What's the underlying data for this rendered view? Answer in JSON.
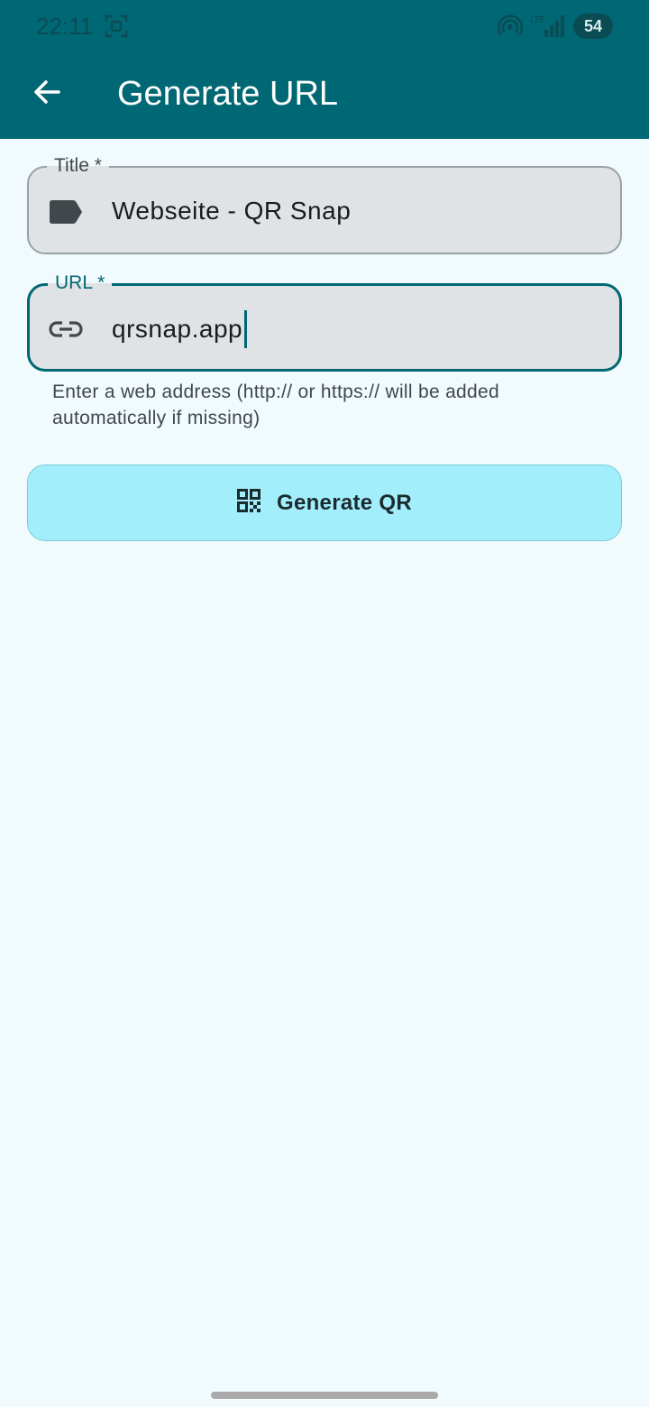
{
  "status_bar": {
    "time": "22:11",
    "network": "LTE",
    "battery": "54"
  },
  "app_bar": {
    "title": "Generate URL"
  },
  "form": {
    "title_field": {
      "label": "Title *",
      "value": "Webseite - QR Snap",
      "icon": "label-icon"
    },
    "url_field": {
      "label": "URL *",
      "value": "qrsnap.app",
      "icon": "link-icon",
      "helper": "Enter a web address (http:// or https:// will be added automatically if missing)"
    },
    "generate_button": {
      "label": "Generate QR",
      "icon": "qr-code-icon"
    }
  },
  "colors": {
    "primary": "#006874",
    "background": "#f1fafc",
    "field_fill": "#e0e3e5",
    "button_fill": "#a3eefb"
  }
}
